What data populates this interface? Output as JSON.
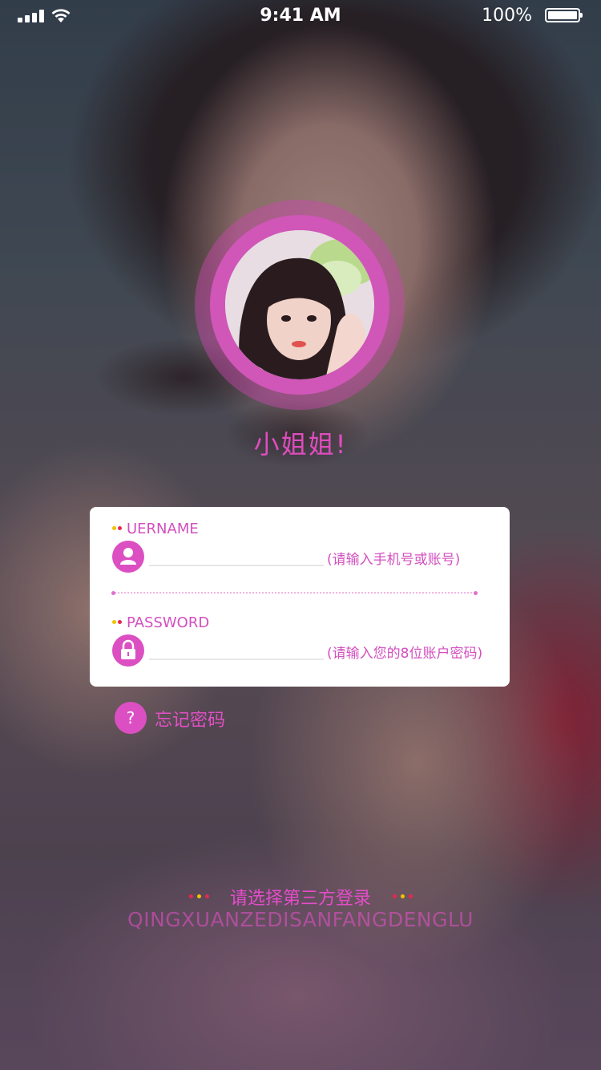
{
  "status_bar": {
    "time": "9:41 AM",
    "battery_percent": "100%",
    "battery_level": 1.0,
    "icons": [
      "signal-icon",
      "wifi-icon",
      "battery-icon"
    ]
  },
  "profile": {
    "nickname": "小姐姐!"
  },
  "login_form": {
    "username": {
      "label": "UERNAME",
      "value": "",
      "hint": "(请输入手机号或账号)",
      "icon": "user-icon"
    },
    "password": {
      "label": "PASSWORD",
      "value": "",
      "hint": "(请输入您的8位账户密码)",
      "icon": "lock-icon"
    }
  },
  "forgot_password": {
    "label": "忘记密码",
    "icon": "question-icon",
    "icon_glyph": "?"
  },
  "third_party": {
    "title": "请选择第三方登录",
    "subtitle": "QINGXUANZEDISANFANGDENGLU"
  },
  "colors": {
    "accent": "#dc4fc2",
    "accent_text": "#e250c5",
    "card_bg": "#ffffff",
    "dot_yellow": "#f2c200",
    "dot_red": "#e6284f"
  }
}
